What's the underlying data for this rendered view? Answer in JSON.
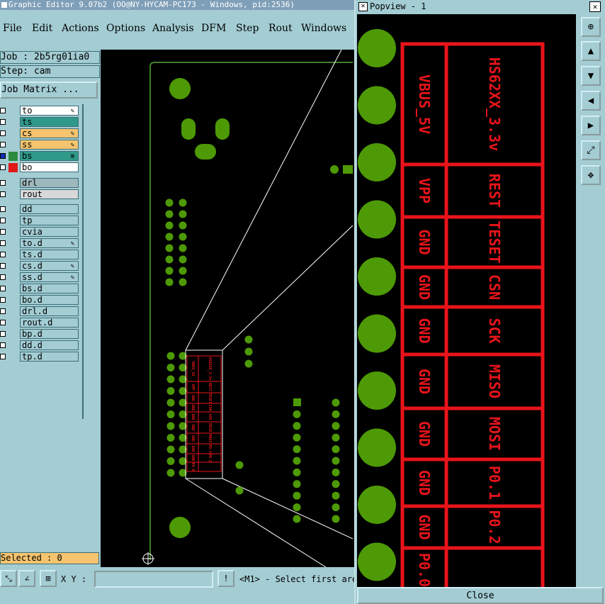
{
  "main_window": {
    "title": "Graphic Editor 9.07b2 (OO@NY-HYCAM-PC173 - Windows, pid:2536)",
    "menu": [
      "File",
      "Edit",
      "Actions",
      "Options",
      "Analysis",
      "DFM",
      "Step",
      "Rout",
      "Windows"
    ],
    "job_label": "Job : 2b5rg01ia0",
    "step_label": "Step: cam",
    "job_matrix_button": "Job Matrix ...",
    "selected_label": "Selected : 0",
    "xy_label": "X Y :",
    "status_message": "<M1> - Select first are"
  },
  "layers": [
    {
      "name": "to",
      "name_bg": "#ffffff",
      "mark": "✎"
    },
    {
      "name": "ts",
      "name_bg": "#2f9a8a",
      "mark": ""
    },
    {
      "name": "cs",
      "name_bg": "#f6c46e",
      "mark": "✎"
    },
    {
      "name": "ss",
      "name_bg": "#f6c46e",
      "mark": "✎"
    },
    {
      "name": "bs",
      "name_bg": "#2f9a8a",
      "mark": "⊞",
      "swatch": "#2e8b3e",
      "checkbox": "#1030b0"
    },
    {
      "name": "bo",
      "name_bg": "#ffffff",
      "mark": "",
      "swatch": "#e01818"
    },
    {
      "name": "drl",
      "name_bg": "#9fb8bd",
      "mark": ""
    },
    {
      "name": "rout",
      "name_bg": "#d8d8d8",
      "mark": ""
    },
    {
      "name": "dd",
      "name_bg": "#a3ccd3",
      "mark": ""
    },
    {
      "name": "tp",
      "name_bg": "#a3ccd3",
      "mark": ""
    },
    {
      "name": "cvia",
      "name_bg": "#a3ccd3",
      "mark": ""
    },
    {
      "name": "to.d",
      "name_bg": "#a3ccd3",
      "mark": "✎"
    },
    {
      "name": "ts.d",
      "name_bg": "#a3ccd3",
      "mark": ""
    },
    {
      "name": "cs.d",
      "name_bg": "#a3ccd3",
      "mark": "✎"
    },
    {
      "name": "ss.d",
      "name_bg": "#a3ccd3",
      "mark": "✎"
    },
    {
      "name": "bs.d",
      "name_bg": "#a3ccd3",
      "mark": ""
    },
    {
      "name": "bo.d",
      "name_bg": "#a3ccd3",
      "mark": ""
    },
    {
      "name": "drl.d",
      "name_bg": "#a3ccd3",
      "mark": ""
    },
    {
      "name": "rout.d",
      "name_bg": "#a3ccd3",
      "mark": ""
    },
    {
      "name": "bp.d",
      "name_bg": "#a3ccd3",
      "mark": ""
    },
    {
      "name": "dd.d",
      "name_bg": "#a3ccd3",
      "mark": ""
    },
    {
      "name": "tp.d",
      "name_bg": "#a3ccd3",
      "mark": ""
    }
  ],
  "popview": {
    "title": "Popview - 1",
    "close_label": "Close",
    "table": [
      [
        "VBUS_5V",
        "HS62XX_3.3v"
      ],
      [
        "VPP",
        "REST"
      ],
      [
        "GND",
        "TESET"
      ],
      [
        "GND",
        "CSN"
      ],
      [
        "GND",
        "SCK"
      ],
      [
        "GND",
        "MISO"
      ],
      [
        "GND",
        "MOSI"
      ],
      [
        "GND",
        "P0.1"
      ],
      [
        "GND",
        "P0.2"
      ],
      [
        "P0.0",
        ""
      ]
    ]
  },
  "colors": {
    "panel_bg": "#a3ccd3",
    "pad_green": "#4e9a06",
    "silk_red": "#e8141a",
    "outline_green": "#3f7f2f",
    "selected_bar": "#f6c46e"
  }
}
